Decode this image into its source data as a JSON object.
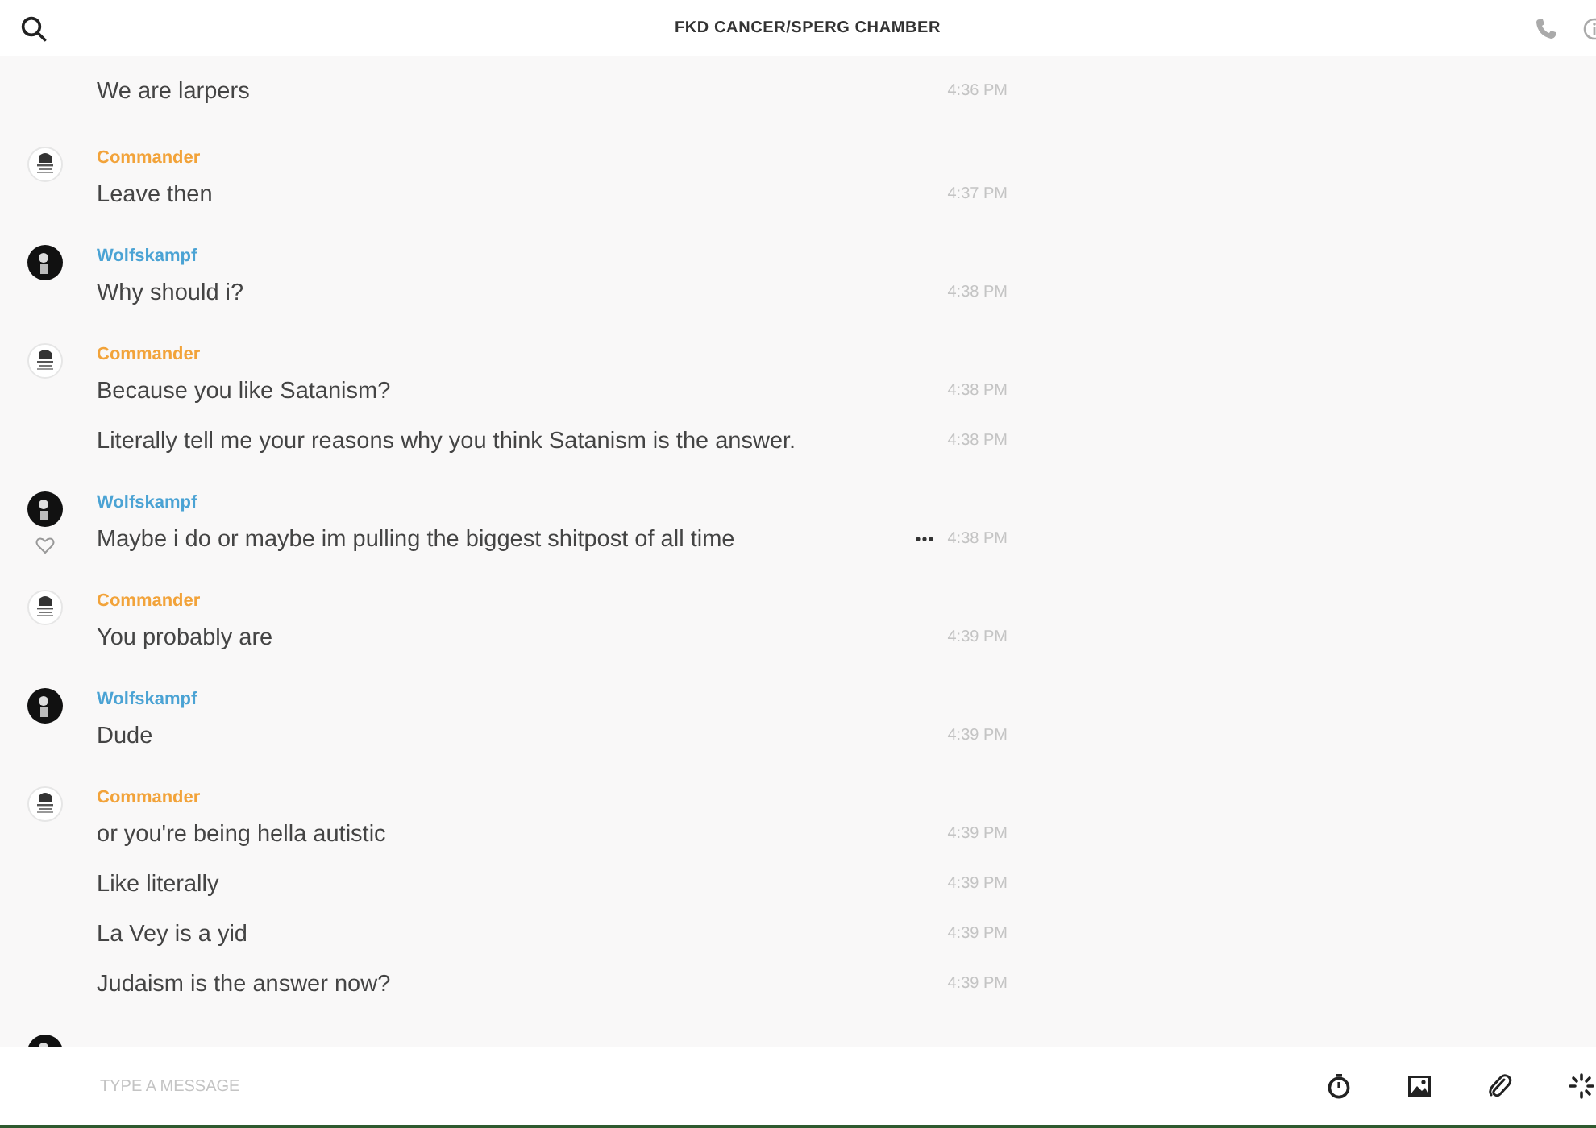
{
  "header": {
    "title": "FKD CANCER/SPERG CHAMBER"
  },
  "groups": [
    {
      "lines": [
        {
          "text": "We are larpers",
          "time": "4:36 PM",
          "hovered": false
        }
      ]
    },
    {
      "author": "Commander",
      "color": "#f2a33a",
      "kind": "light",
      "lines": [
        {
          "text": "Leave then",
          "time": "4:37 PM",
          "hovered": false
        }
      ]
    },
    {
      "author": "Wolfskampf",
      "color": "#4ba3d4",
      "kind": "dark",
      "lines": [
        {
          "text": "Why should i?",
          "time": "4:38 PM",
          "hovered": false
        }
      ]
    },
    {
      "author": "Commander",
      "color": "#f2a33a",
      "kind": "light",
      "lines": [
        {
          "text": "Because you like Satanism?",
          "time": "4:38 PM",
          "hovered": false
        },
        {
          "text": "Literally tell me your reasons why you think Satanism is the answer.",
          "time": "4:38 PM",
          "hovered": false
        }
      ]
    },
    {
      "author": "Wolfskampf",
      "color": "#4ba3d4",
      "kind": "dark",
      "lines": [
        {
          "text": "Maybe i do or maybe im pulling the biggest shitpost of all time",
          "time": "4:38 PM",
          "hovered": true
        }
      ]
    },
    {
      "author": "Commander",
      "color": "#f2a33a",
      "kind": "light",
      "lines": [
        {
          "text": "You probably are",
          "time": "4:39 PM",
          "hovered": false
        }
      ]
    },
    {
      "author": "Wolfskampf",
      "color": "#4ba3d4",
      "kind": "dark",
      "lines": [
        {
          "text": "Dude",
          "time": "4:39 PM",
          "hovered": false
        }
      ]
    },
    {
      "author": "Commander",
      "color": "#f2a33a",
      "kind": "light",
      "lines": [
        {
          "text": "or you're being hella autistic",
          "time": "4:39 PM",
          "hovered": false
        },
        {
          "text": "Like literally",
          "time": "4:39 PM",
          "hovered": false
        },
        {
          "text": "La Vey is a yid",
          "time": "4:39 PM",
          "hovered": false
        },
        {
          "text": "Judaism is the answer now?",
          "time": "4:39 PM",
          "hovered": false
        }
      ]
    },
    {
      "kind": "dark"
    }
  ],
  "composer": {
    "placeholder": "TYPE A MESSAGE"
  }
}
